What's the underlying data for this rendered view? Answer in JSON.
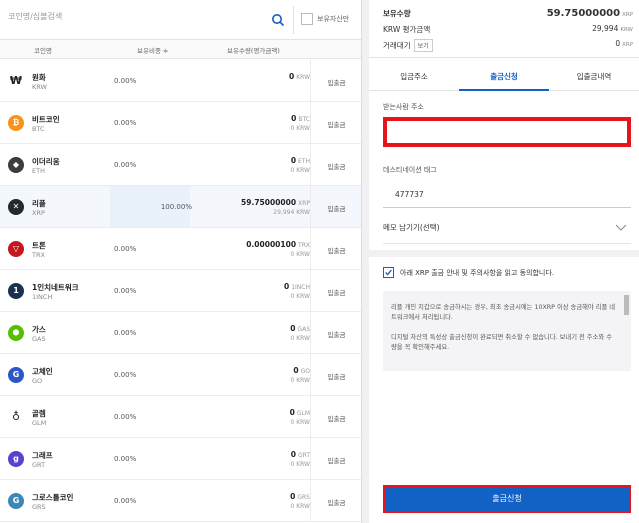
{
  "search": {
    "placeholder": "코인명/심볼검색",
    "owned_only_label": "보유자산만"
  },
  "table": {
    "headers": [
      "코인명",
      "보유비중 ≑",
      "보유수량(평가금액)"
    ],
    "rows": [
      {
        "name": "원화",
        "symbol": "KRW",
        "icon": "won-icon",
        "icon_color": "#ffffff",
        "ratio": "0.00%",
        "qty": "0",
        "qty_unit": "KRW",
        "krw": "",
        "button": "입출금"
      },
      {
        "name": "비트코인",
        "symbol": "BTC",
        "icon": "bitcoin-icon",
        "icon_color": "#f7931a",
        "ratio": "0.00%",
        "qty": "0",
        "qty_unit": "BTC",
        "krw": "0 KRW",
        "button": "입출금"
      },
      {
        "name": "이더리움",
        "symbol": "ETH",
        "icon": "ethereum-icon",
        "icon_color": "#3c3c3d",
        "ratio": "0.00%",
        "qty": "0",
        "qty_unit": "ETH",
        "krw": "0 KRW",
        "button": "입출금"
      },
      {
        "name": "리플",
        "symbol": "XRP",
        "icon": "ripple-icon",
        "icon_color": "#23292f",
        "ratio": "100.00%",
        "qty": "59.75000000",
        "qty_unit": "XRP",
        "krw": "29,994 KRW",
        "button": "입출금"
      },
      {
        "name": "트론",
        "symbol": "TRX",
        "icon": "tron-icon",
        "icon_color": "#c4161c",
        "ratio": "0.00%",
        "qty": "0.00000100",
        "qty_unit": "TRX",
        "krw": "0 KRW",
        "button": "입출금"
      },
      {
        "name": "1인치네트워크",
        "symbol": "1INCH",
        "icon": "1inch-icon",
        "icon_color": "#1b314f",
        "ratio": "0.00%",
        "qty": "0",
        "qty_unit": "1INCH",
        "krw": "0 KRW",
        "button": "입출금"
      },
      {
        "name": "가스",
        "symbol": "GAS",
        "icon": "gas-icon",
        "icon_color": "#58bf00",
        "ratio": "0.00%",
        "qty": "0",
        "qty_unit": "GAS",
        "krw": "0 KRW",
        "button": "입출금"
      },
      {
        "name": "고체인",
        "symbol": "GO",
        "icon": "gochain-icon",
        "icon_color": "#2d56c8",
        "ratio": "0.00%",
        "qty": "0",
        "qty_unit": "GO",
        "krw": "0 KRW",
        "button": "입출금"
      },
      {
        "name": "골렘",
        "symbol": "GLM",
        "icon": "golem-icon",
        "icon_color": "#ffffff",
        "ratio": "0.00%",
        "qty": "0",
        "qty_unit": "GLM",
        "krw": "0 KRW",
        "button": "입출금"
      },
      {
        "name": "그래프",
        "symbol": "GRT",
        "icon": "graph-icon",
        "icon_color": "#5942cc",
        "ratio": "0.00%",
        "qty": "0",
        "qty_unit": "GRT",
        "krw": "0 KRW",
        "button": "입출금"
      },
      {
        "name": "그로스톨코인",
        "symbol": "GRS",
        "icon": "groestlcoin-icon",
        "icon_color": "#3a88b6",
        "ratio": "0.00%",
        "qty": "0",
        "qty_unit": "GRS",
        "krw": "0 KRW",
        "button": "입출금"
      }
    ]
  },
  "summary": {
    "holding_label": "보유수량",
    "holding_value": "59.75000000",
    "holding_unit": "XRP",
    "krw_label": "KRW 평가금액",
    "krw_value": "29,994",
    "krw_unit": "KRW",
    "pending_label": "거래대기",
    "view_label": "보기",
    "pending_value": "0",
    "pending_unit": "XRP"
  },
  "tabs": [
    "입금주소",
    "출금신청",
    "입출금내역"
  ],
  "form": {
    "address_label": "받는사람 주소",
    "tag_label": "데스티네이션 태그",
    "tag_value": "477737",
    "memo_label": "메모 남기기(선택)",
    "agree_text": "아래 XRP 출금 안내 및 주의사항을 읽고 동의합니다.",
    "notice_1": "리플 개인 지갑으로 송금하시는 경우, 최초 송금시에는 10XRP 이상 송금해야 리플 네트워크에서 처리됩니다.",
    "notice_2": "디지털 자산의 특성상 출금신청이 완료되면 취소할 수 없습니다. 보내기 전 주소와 수량을 꼭 확인해주세요.",
    "submit_label": "출금신청"
  },
  "colors": {
    "accent": "#1261c4",
    "highlight_red": "#e8141c"
  }
}
